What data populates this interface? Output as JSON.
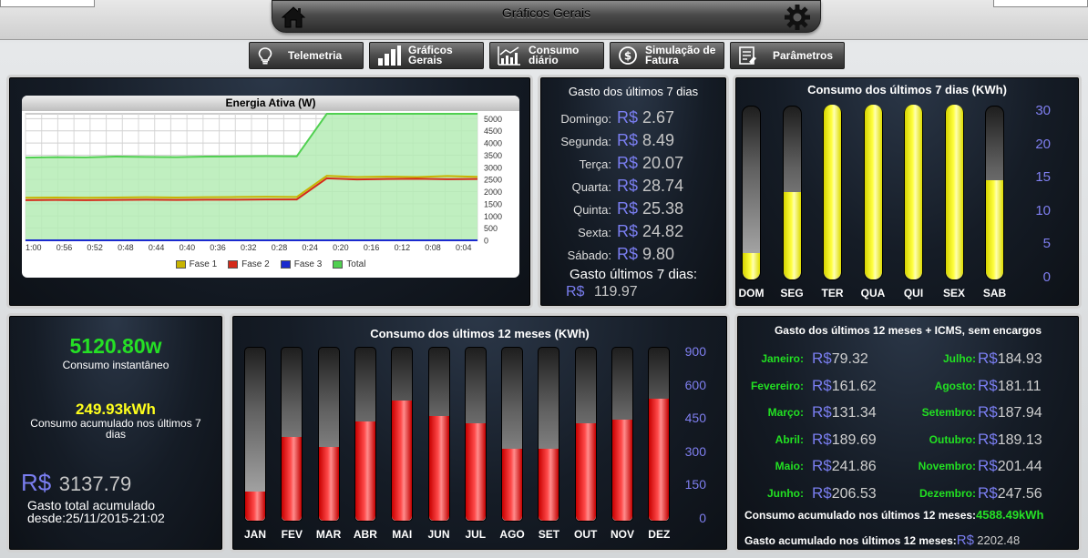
{
  "header": {
    "title": "Gráficos Gerais"
  },
  "nav": [
    {
      "label": "Telemetria",
      "icon": "lightbulb-icon"
    },
    {
      "label": "Gráficos Gerais",
      "icon": "bar-chart-icon"
    },
    {
      "label": "Consumo diário",
      "icon": "daily-chart-icon"
    },
    {
      "label": "Simulação de Fatura",
      "icon": "dollar-icon"
    },
    {
      "label": "Parâmetros",
      "icon": "checklist-icon"
    }
  ],
  "energy_chart": {
    "chart_data": {
      "type": "line",
      "title": "Energia Ativa (W)",
      "x": [
        "1:00",
        "0:56",
        "0:52",
        "0:48",
        "0:44",
        "0:40",
        "0:36",
        "0:32",
        "0:28",
        "0:24",
        "0:20",
        "0:16",
        "0:12",
        "0:08",
        "0:04"
      ],
      "ylim": [
        0,
        5000
      ],
      "yticks": [
        0,
        500,
        1000,
        1500,
        2000,
        2500,
        3000,
        3500,
        4000,
        4500,
        5000
      ],
      "series": [
        {
          "name": "Fase 1",
          "color": "#c8b400",
          "values": [
            1750,
            1760,
            1750,
            1760,
            1770,
            1760,
            1770,
            1780,
            1790,
            1780,
            2650,
            2600,
            2620,
            2600,
            2640,
            2610
          ]
        },
        {
          "name": "Fase 2",
          "color": "#d42a1a",
          "values": [
            1650,
            1660,
            1650,
            1660,
            1670,
            1660,
            1670,
            1670,
            1680,
            1680,
            2550,
            2500,
            2520,
            2530,
            2510,
            2520
          ]
        },
        {
          "name": "Fase 3",
          "color": "#1a2acf",
          "values": [
            0,
            0,
            0,
            0,
            0,
            0,
            0,
            0,
            0,
            0,
            0,
            0,
            0,
            0,
            0,
            0
          ]
        },
        {
          "name": "Total",
          "color": "#50d050",
          "values": [
            3400,
            3420,
            3410,
            3440,
            3430,
            3420,
            3440,
            3450,
            3460,
            3450,
            5200,
            5200,
            5200,
            5200,
            5200,
            5200
          ]
        }
      ]
    }
  },
  "weekly_cost": {
    "title": "Gasto dos últimos 7 dias",
    "currency": "R$",
    "rows": [
      {
        "day": "Domingo:",
        "value": "2.67"
      },
      {
        "day": "Segunda:",
        "value": "8.49"
      },
      {
        "day": "Terça:",
        "value": "20.07"
      },
      {
        "day": "Quarta:",
        "value": "28.74"
      },
      {
        "day": "Quinta:",
        "value": "25.38"
      },
      {
        "day": "Sexta:",
        "value": "24.82"
      },
      {
        "day": "Sábado:",
        "value": "9.80"
      }
    ],
    "total_label": "Gasto últimos 7 dias:",
    "total_value": "119.97"
  },
  "weekly_consumption": {
    "chart_data": {
      "type": "bar",
      "title": "Consumo dos últimos 7 dias (KWh)",
      "categories": [
        "DOM",
        "SEG",
        "TER",
        "QUA",
        "QUI",
        "SEX",
        "SAB"
      ],
      "values": [
        4.5,
        15,
        30,
        30,
        30,
        30,
        17
      ],
      "ylim": [
        0,
        30
      ],
      "yticks": [
        "30",
        "20",
        "15",
        "10",
        "5",
        "0"
      ]
    }
  },
  "stats": {
    "instant_value": "5120.80w",
    "instant_label": "Consumo instantâneo",
    "accum_value": "249.93kWh",
    "accum_label": "Consumo acumulado nos últimos 7 dias",
    "currency": "R$",
    "total_cost": "3137.79",
    "total_label": "Gasto total acumulado desde:25/11/2015-21:02"
  },
  "monthly_consumption": {
    "chart_data": {
      "type": "bar",
      "title": "Consumo dos últimos 12 meses (KWh)",
      "categories": [
        "JAN",
        "FEV",
        "MAR",
        "ABR",
        "MAI",
        "JUN",
        "JUL",
        "AGO",
        "SET",
        "OUT",
        "NOV",
        "DEZ"
      ],
      "values": [
        150,
        430,
        380,
        510,
        620,
        540,
        500,
        370,
        370,
        500,
        520,
        630
      ],
      "ylim": [
        0,
        900
      ],
      "yticks": [
        "900",
        "600",
        "450",
        "300",
        "150",
        "0"
      ]
    }
  },
  "monthly_cost": {
    "title": "Gasto dos últimos 12 meses + ICMS, sem encargos",
    "currency": "R$",
    "left": [
      {
        "month": "Janeiro:",
        "value": "79.32"
      },
      {
        "month": "Fevereiro:",
        "value": "161.62"
      },
      {
        "month": "Março:",
        "value": "131.34"
      },
      {
        "month": "Abril:",
        "value": "189.69"
      },
      {
        "month": "Maio:",
        "value": "241.86"
      },
      {
        "month": "Junho:",
        "value": "206.53"
      }
    ],
    "right": [
      {
        "month": "Julho:",
        "value": "184.93"
      },
      {
        "month": "Agosto:",
        "value": "181.11"
      },
      {
        "month": "Setembro:",
        "value": "187.94"
      },
      {
        "month": "Outubro:",
        "value": "189.13"
      },
      {
        "month": "Novembro:",
        "value": "201.44"
      },
      {
        "month": "Dezembro:",
        "value": "247.56"
      }
    ],
    "consumption_label": "Consumo acumulado nos últimos 12 meses:",
    "consumption_value": "4588.49kWh",
    "cost_label": "Gasto acumulado nos últimos 12 meses:",
    "cost_value": "2202.48"
  }
}
